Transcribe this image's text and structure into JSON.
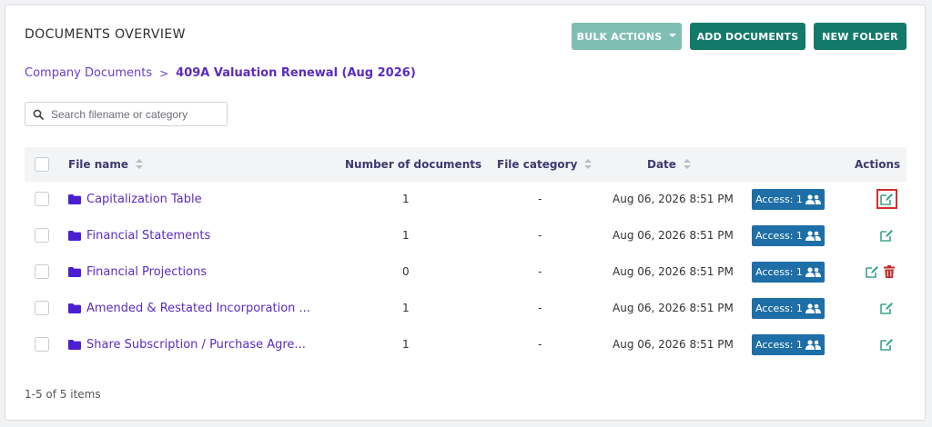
{
  "page": {
    "title": "DOCUMENTS OVERVIEW",
    "buttons": {
      "bulk_actions": "BULK ACTIONS",
      "add_documents": "ADD DOCUMENTS",
      "new_folder": "NEW FOLDER"
    }
  },
  "breadcrumb": {
    "parent": "Company Documents",
    "separator": ">",
    "current": "409A Valuation Renewal (Aug 2026)"
  },
  "search": {
    "placeholder": "Search filename or category",
    "value": ""
  },
  "table": {
    "headers": {
      "file_name": "File name",
      "number_of_documents": "Number of documents",
      "file_category": "File category",
      "date": "Date",
      "actions": "Actions"
    },
    "rows": [
      {
        "name": "Capitalization Table",
        "count": "1",
        "category": "-",
        "date": "Aug 06, 2026 8:51 PM",
        "access": "Access: 1"
      },
      {
        "name": "Financial Statements",
        "count": "1",
        "category": "-",
        "date": "Aug 06, 2026 8:51 PM",
        "access": "Access: 1"
      },
      {
        "name": "Financial Projections",
        "count": "0",
        "category": "-",
        "date": "Aug 06, 2026 8:51 PM",
        "access": "Access: 1"
      },
      {
        "name": "Amended & Restated Incorporation ...",
        "count": "1",
        "category": "-",
        "date": "Aug 06, 2026 8:51 PM",
        "access": "Access: 1"
      },
      {
        "name": "Share Subscription / Purchase Agre...",
        "count": "1",
        "category": "-",
        "date": "Aug 06, 2026 8:51 PM",
        "access": "Access: 1"
      }
    ]
  },
  "footer": {
    "pagination": "1-5 of 5 items"
  },
  "colors": {
    "primary_teal": "#137a6a",
    "light_teal": "#7fbfb3",
    "link_purple": "#5b2bbf",
    "access_blue": "#1e6ea7",
    "delete_red": "#c62828",
    "edit_teal": "#3aa58e",
    "highlight_red": "#d0302f"
  },
  "icons": {
    "search": "search-icon",
    "folder": "folder-icon",
    "users": "users-icon",
    "edit": "edit-icon",
    "delete": "trash-icon",
    "sort": "sort-icon",
    "dropdown": "chevron-down-icon"
  }
}
